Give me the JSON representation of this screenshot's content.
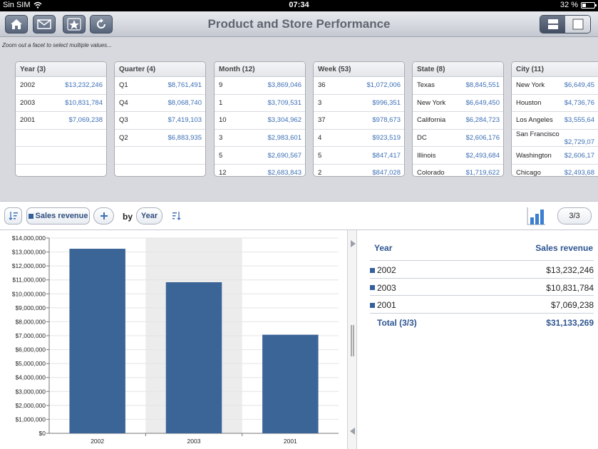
{
  "status": {
    "carrier": "Sin SIM",
    "time": "07:34",
    "battery": "32 %",
    "battery_level": 0.32
  },
  "toolbar": {
    "title": "Product and Store Performance",
    "buttons": [
      "home-icon",
      "mail-icon",
      "favorites-icon",
      "refresh-icon"
    ]
  },
  "hint": "Zoom out a facet to select multiple values...",
  "facets": [
    {
      "title": "Year (3)",
      "rows": [
        {
          "label": "2002",
          "value": "$13,232,246"
        },
        {
          "label": "2003",
          "value": "$10,831,784"
        },
        {
          "label": "2001",
          "value": "$7,069,238"
        },
        {
          "label": "",
          "value": ""
        },
        {
          "label": "",
          "value": ""
        },
        {
          "label": "",
          "value": ""
        }
      ]
    },
    {
      "title": "Quarter (4)",
      "rows": [
        {
          "label": "Q1",
          "value": "$8,761,491"
        },
        {
          "label": "Q4",
          "value": "$8,068,740"
        },
        {
          "label": "Q3",
          "value": "$7,419,103"
        },
        {
          "label": "Q2",
          "value": "$6,883,935"
        },
        {
          "label": "",
          "value": ""
        },
        {
          "label": "",
          "value": ""
        }
      ]
    },
    {
      "title": "Month (12)",
      "rows": [
        {
          "label": "9",
          "value": "$3,869,046"
        },
        {
          "label": "1",
          "value": "$3,709,531"
        },
        {
          "label": "10",
          "value": "$3,304,962"
        },
        {
          "label": "3",
          "value": "$2,983,601"
        },
        {
          "label": "5",
          "value": "$2,690,567"
        },
        {
          "label": "12",
          "value": "$2,683,843"
        }
      ]
    },
    {
      "title": "Week (53)",
      "rows": [
        {
          "label": "36",
          "value": "$1,072,006"
        },
        {
          "label": "3",
          "value": "$996,351"
        },
        {
          "label": "37",
          "value": "$978,673"
        },
        {
          "label": "4",
          "value": "$923,519"
        },
        {
          "label": "5",
          "value": "$847,417"
        },
        {
          "label": "2",
          "value": "$847,028"
        }
      ]
    },
    {
      "title": "State (8)",
      "rows": [
        {
          "label": "Texas",
          "value": "$8,845,551"
        },
        {
          "label": "New York",
          "value": "$6,649,450"
        },
        {
          "label": "California",
          "value": "$6,284,723"
        },
        {
          "label": "DC",
          "value": "$2,606,176"
        },
        {
          "label": "Illinois",
          "value": "$2,493,684"
        },
        {
          "label": "Colorado",
          "value": "$1,719,622"
        }
      ]
    },
    {
      "title": "City (11)",
      "rows": [
        {
          "label": "New York",
          "value": "$6,649,45"
        },
        {
          "label": "Houston",
          "value": "$4,736,76"
        },
        {
          "label": "Los Angeles",
          "value": "$3,555,64"
        },
        {
          "label": "San Francisco",
          "value": "$2,729,07"
        },
        {
          "label": "Washington",
          "value": "$2,606,17"
        },
        {
          "label": "Chicago",
          "value": "$2,493,68"
        }
      ]
    }
  ],
  "analysis": {
    "measure": "Sales revenue",
    "by": "by",
    "dimension": "Year",
    "page": "3/3"
  },
  "table": {
    "col_year": "Year",
    "col_revenue": "Sales revenue",
    "rows": [
      {
        "year": "2002",
        "revenue": "$13,232,246"
      },
      {
        "year": "2003",
        "revenue": "$10,831,784"
      },
      {
        "year": "2001",
        "revenue": "$7,069,238"
      }
    ],
    "total_label": "Total (3/3)",
    "total_value": "$31,133,269"
  },
  "chart_data": {
    "type": "bar",
    "categories": [
      "2002",
      "2003",
      "2001"
    ],
    "values": [
      13232246,
      10831784,
      7069238
    ],
    "ylim": [
      0,
      14000000
    ],
    "yticks": [
      0,
      1000000,
      2000000,
      3000000,
      4000000,
      5000000,
      6000000,
      7000000,
      8000000,
      9000000,
      10000000,
      11000000,
      12000000,
      13000000,
      14000000
    ],
    "ytick_labels": [
      "$0",
      "$1,000,000",
      "$2,000,000",
      "$3,000,000",
      "$4,000,000",
      "$5,000,000",
      "$6,000,000",
      "$7,000,000",
      "$8,000,000",
      "$9,000,000",
      "$10,000,000",
      "$11,000,000",
      "$12,000,000",
      "$13,000,000",
      "$14,000,000"
    ],
    "highlighted_category": "2003",
    "grid": true,
    "bar_color": "#3b6497"
  }
}
